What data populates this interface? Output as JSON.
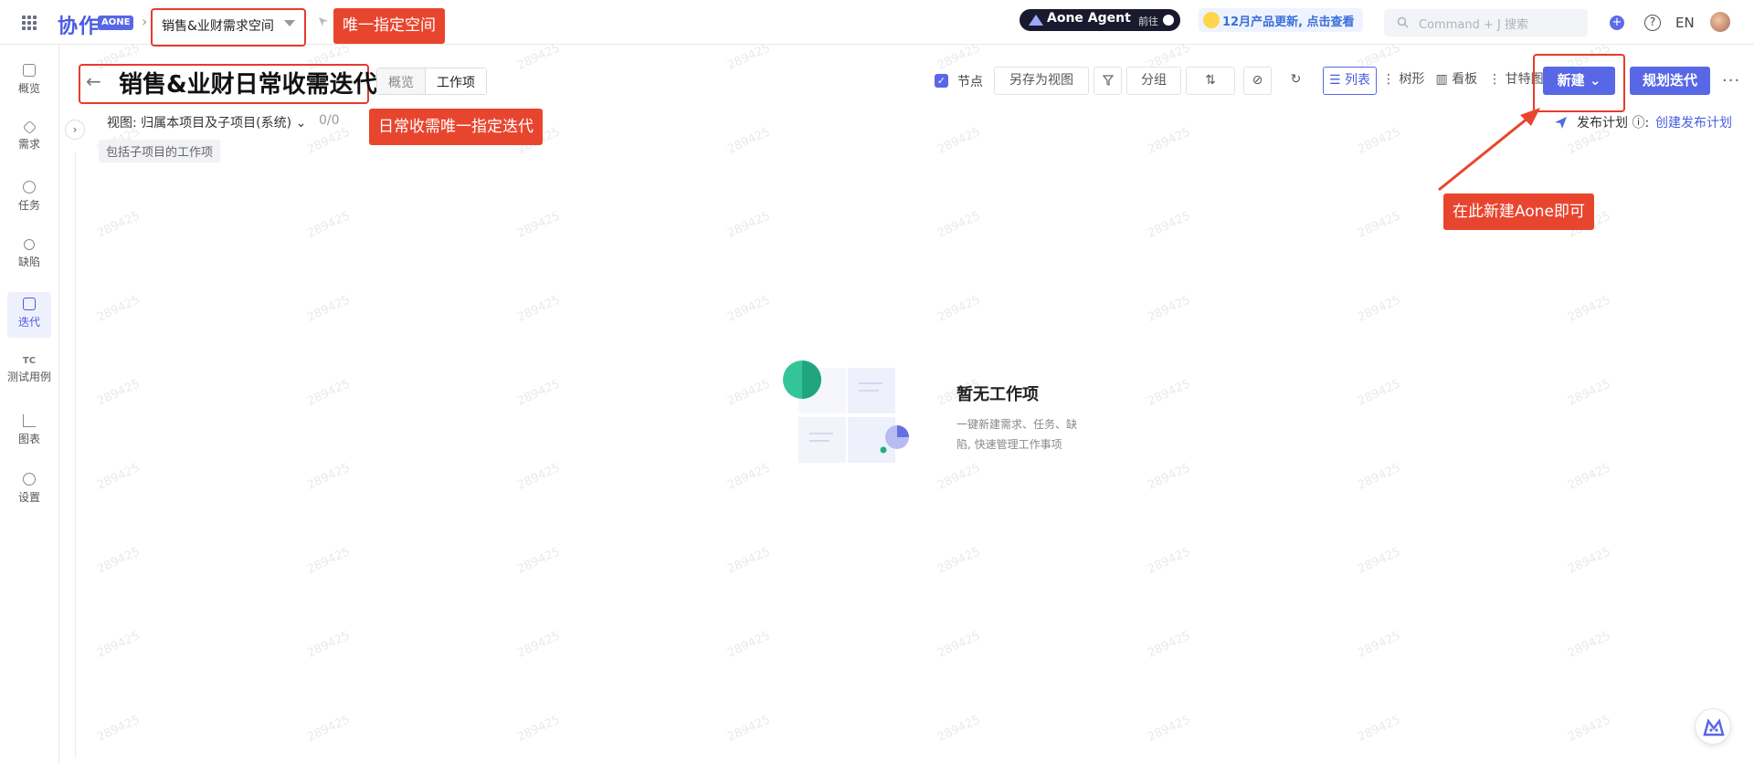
{
  "topbar": {
    "logo_text": "协作",
    "logo_badge": "AONE",
    "breadcrumb_sep": "›",
    "space_name": "销售&业财需求空间",
    "agent_label": "Aone Agent",
    "agent_go": "前往",
    "news_text": "12月产品更新, 点击查看",
    "search_placeholder": "Command + J 搜索",
    "plus_label": "+",
    "help_label": "?",
    "lang_label": "EN"
  },
  "sidebar": {
    "items": [
      {
        "label": "概览",
        "icon": "monitor-icon"
      },
      {
        "label": "需求",
        "icon": "layers-icon"
      },
      {
        "label": "任务",
        "icon": "lightbulb-icon"
      },
      {
        "label": "缺陷",
        "icon": "bug-icon"
      },
      {
        "label": "迭代",
        "icon": "flask-icon",
        "active": true
      },
      {
        "label": "测试用例",
        "icon": "tc-icon"
      },
      {
        "label": "图表",
        "icon": "chart-icon"
      },
      {
        "label": "设置",
        "icon": "gear-icon"
      }
    ],
    "tc_glyph": "TC"
  },
  "header": {
    "back_glyph": "←",
    "title": "销售&业财日常收需迭代",
    "tabs": [
      "概览",
      "工作项"
    ],
    "view_prefix": "视图:",
    "view_name": "归属本项目及子项目(系统)",
    "count": "0/0",
    "chip": "包括子项目的工作项"
  },
  "toolbar": {
    "nodes_label": "节点",
    "checkbox_glyph": "✓",
    "save_view": "另存为视图",
    "group": "分组",
    "view_tabs": [
      "列表",
      "树形",
      "看板",
      "甘特图"
    ],
    "new_label": "新建",
    "plan_label": "规划迭代",
    "more_glyph": "···",
    "publish_label": "发布计划",
    "publish_link": "创建发布计划"
  },
  "empty_state": {
    "title": "暂无工作项",
    "desc": "一键新建需求、任务、缺陷, 快速管理工作事项"
  },
  "callouts": {
    "space": "唯一指定空间",
    "iteration": "日常收需唯一指定迭代",
    "new": "在此新建Aone即可"
  },
  "watermark": "289425",
  "colors": {
    "accent": "#5867e6",
    "callout": "#e8452f",
    "highlight_border": "#e63b2e"
  }
}
